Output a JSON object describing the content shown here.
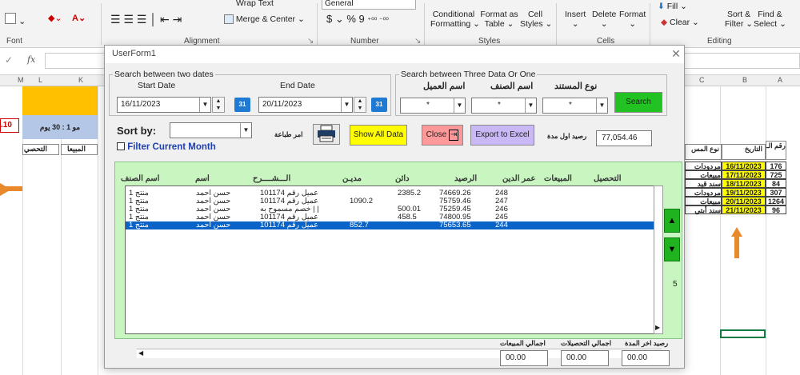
{
  "ribbon": {
    "wrap_text": "Wrap Text",
    "number_format": "General",
    "merge_center": "Merge & Center",
    "currency": "$",
    "percent": "%",
    "comma": "9",
    "cond_fmt": "Conditional",
    "cond_fmt2": "Formatting",
    "fmt_table": "Format as",
    "fmt_table2": "Table",
    "cell_styles": "Cell",
    "cell_styles2": "Styles",
    "insert": "Insert",
    "delete": "Delete",
    "format": "Format",
    "fill": "Fill",
    "clear": "Clear",
    "sort_filter": "Sort &",
    "sort_filter2": "Filter",
    "find_select": "Find &",
    "find_select2": "Select",
    "groups": {
      "font": "Font",
      "alignment": "Alignment",
      "number": "Number",
      "styles": "Styles",
      "cells": "Cells",
      "editing": "Editing"
    }
  },
  "formula_bar": {
    "fx": "fx"
  },
  "sheet": {
    "columns_left": [
      "M",
      "L",
      "K"
    ],
    "columns_right": [
      "C",
      "B",
      "A"
    ],
    "left_header1": "مو 1 : 30 يوم",
    "left_col1": "التحصي",
    "left_col2": "المبيعا",
    "left_val": ".10",
    "right_headers": [
      "نوع المس",
      "التاريخ",
      "رقم الـ"
    ],
    "right_rows": [
      {
        "type": "مردودات مبيعا",
        "date": "16/11/2023",
        "num": "176"
      },
      {
        "type": "مبيعات",
        "date": "17/11/2023",
        "num": "725"
      },
      {
        "type": "سند قيد",
        "date": "18/11/2023",
        "num": "84"
      },
      {
        "type": "مردودات مبيعا",
        "date": "19/11/2023",
        "num": "307"
      },
      {
        "type": "مبيعات",
        "date": "20/11/2023",
        "num": "1264"
      },
      {
        "type": "سند أبتي",
        "date": "21/11/2023",
        "num": "96"
      }
    ]
  },
  "form": {
    "title": "UserForm1",
    "date_frame": {
      "legend": "Search between two dates",
      "start_label": "Start Date",
      "end_label": "End Date",
      "start_value": "16/11/2023",
      "end_value": "20/11/2023",
      "cal_label": "31"
    },
    "search_frame": {
      "legend": "Search between Three Data Or One",
      "fields": [
        {
          "label": "اسم العميل",
          "value": "*"
        },
        {
          "label": "اسم الصنف",
          "value": "*"
        },
        {
          "label": "نوع المستند",
          "value": "*"
        }
      ],
      "search_button": "Search"
    },
    "sort_label": "Sort by:",
    "filter_checkbox": "Filter Current Month",
    "print_label": "امر طباعة",
    "show_all": "Show All Data",
    "close": "Close",
    "export": "Export to Excel",
    "opening_balance_label": "رصيد اول مدة",
    "opening_balance": "77,054.46",
    "list_headers": [
      "اسم الصنف",
      "اسم",
      "الـــشــــرح",
      "مديـن",
      "دائن",
      "الرصيد",
      "عمر الدين",
      "المبيعات",
      "التحصيل"
    ],
    "rows": [
      {
        "item": "منتج 1",
        "name": "حسن احمد",
        "desc": "عميل رقم 101174",
        "debit": "",
        "credit": "2385.2",
        "balance": "74669.26",
        "age": "248"
      },
      {
        "item": "منتج 1",
        "name": "حسن احمد",
        "desc": "عميل رقم 101174",
        "debit": "1090.2",
        "credit": "",
        "balance": "75759.46",
        "age": "247"
      },
      {
        "item": "منتج 1",
        "name": "حسن احمد",
        "desc": "خصم مسموح به | |",
        "debit": "",
        "credit": "500.01",
        "balance": "75259.45",
        "age": "246"
      },
      {
        "item": "منتج 1",
        "name": "حسن احمد",
        "desc": "عميل رقم 101174",
        "debit": "",
        "credit": "458.5",
        "balance": "74800.95",
        "age": "245"
      },
      {
        "item": "منتج 1",
        "name": "حسن احمد",
        "desc": "عميل رقم 101174",
        "debit": "852.7",
        "credit": "",
        "balance": "75653.65",
        "age": "244"
      }
    ],
    "row_count": "5",
    "totals": {
      "sales_label": "اجمالي المبيعات",
      "sales": "00.00",
      "collections_label": "اجمالي التحصيلات",
      "collections": "00.00",
      "closing_label": "رصيد اخر المدة",
      "closing": "00.00"
    }
  },
  "colors": {
    "green": "#c8f5c0",
    "yellow": "#ffff00",
    "pink": "#ff9999",
    "violet": "#c9b8f5",
    "select": "#0a64c8",
    "orange": "#e8892c"
  }
}
